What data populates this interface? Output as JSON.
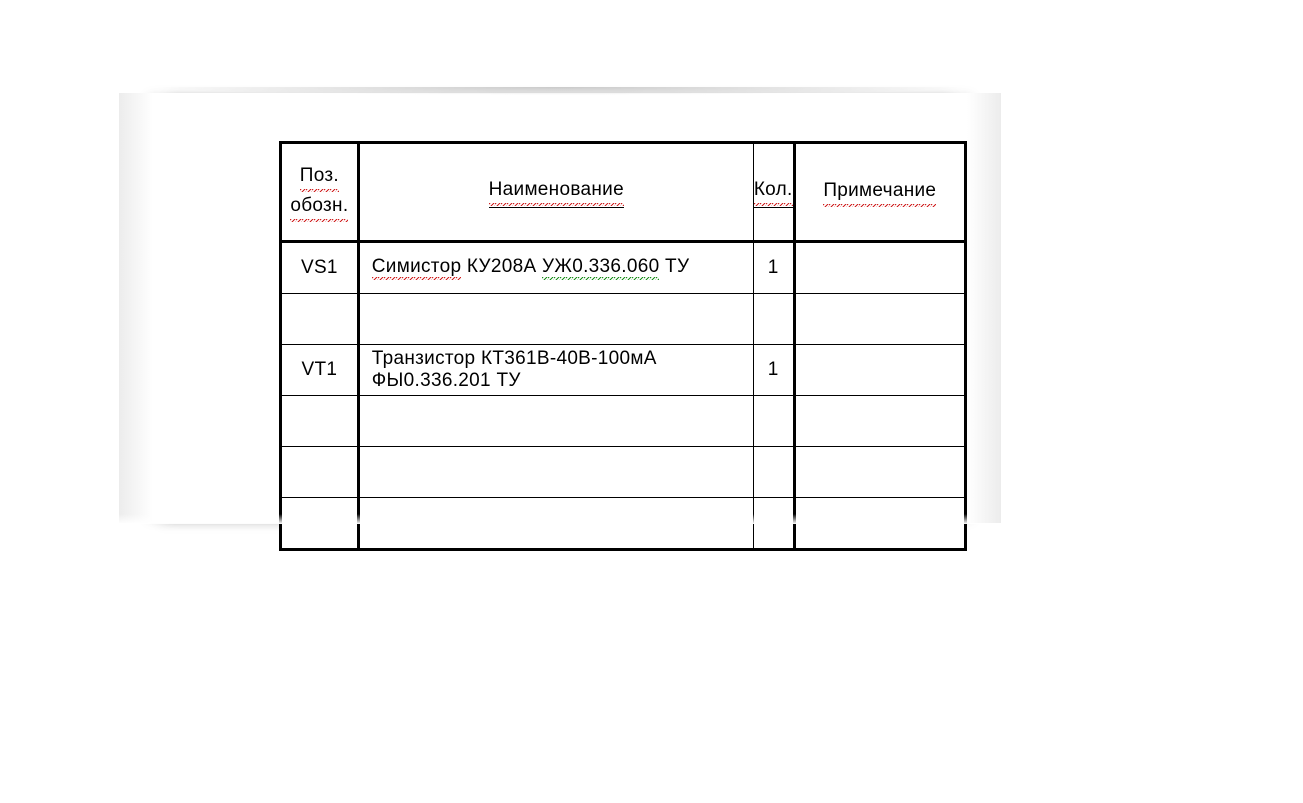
{
  "table": {
    "headers": {
      "col1_line1": "Поз.",
      "col1_line2": "обозн.",
      "col2": "Наименование",
      "col3": "Кол.",
      "col4": "Примечание"
    },
    "rows": [
      {
        "pos": "VS1",
        "name_p1": "Симистор",
        "name_p2": " КУ208А ",
        "name_p3": "УЖ0.336.060",
        "name_p4": " ТУ",
        "qty": "1",
        "note": ""
      },
      {
        "pos": "",
        "name_p1": "",
        "name_p2": "",
        "name_p3": "",
        "name_p4": "",
        "qty": "",
        "note": ""
      },
      {
        "pos": "VT1",
        "name_p1": "Транзистор КТ361В-40В-100мА ФЫ0.336.201 ТУ",
        "name_p2": "",
        "name_p3": "",
        "name_p4": "",
        "qty": "1",
        "note": ""
      },
      {
        "pos": "",
        "name_p1": "",
        "name_p2": "",
        "name_p3": "",
        "name_p4": "",
        "qty": "",
        "note": ""
      },
      {
        "pos": "",
        "name_p1": "",
        "name_p2": "",
        "name_p3": "",
        "name_p4": "",
        "qty": "",
        "note": ""
      },
      {
        "pos": "",
        "name_p1": "",
        "name_p2": "",
        "name_p3": "",
        "name_p4": "",
        "qty": "",
        "note": ""
      }
    ]
  }
}
